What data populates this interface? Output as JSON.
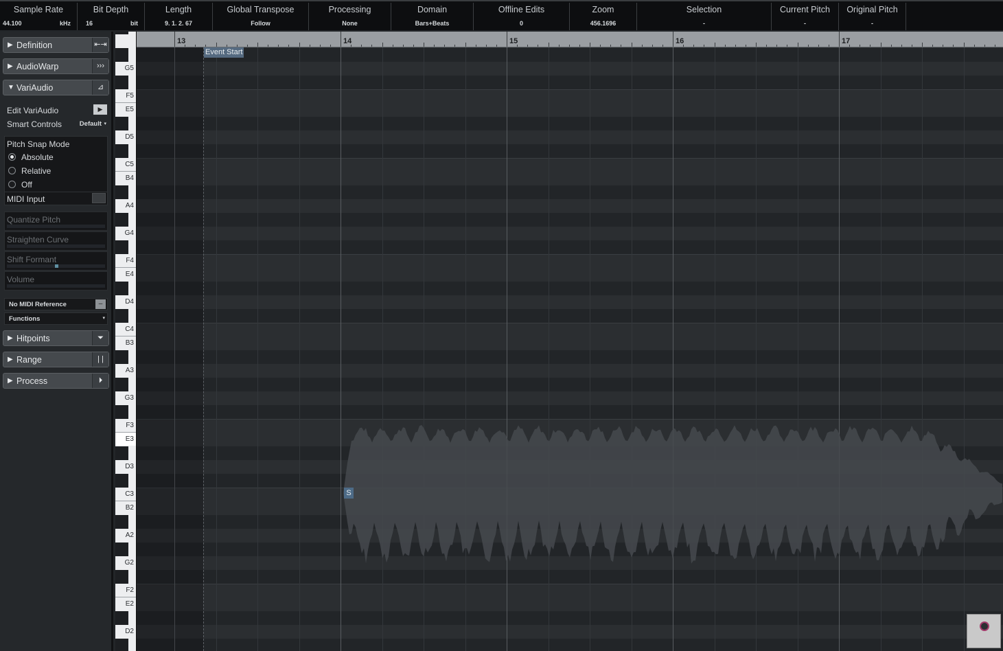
{
  "infoline": {
    "sample_rate": {
      "label": "Sample Rate",
      "value": "44.100",
      "unit": "kHz"
    },
    "bit_depth": {
      "label": "Bit Depth",
      "value": "16",
      "unit": "bit"
    },
    "length": {
      "label": "Length",
      "value": "9. 1. 2. 67"
    },
    "global_transpose": {
      "label": "Global Transpose",
      "value": "Follow"
    },
    "processing": {
      "label": "Processing",
      "value": "None"
    },
    "domain": {
      "label": "Domain",
      "value": "Bars+Beats"
    },
    "offline_edits": {
      "label": "Offline Edits",
      "value": "0"
    },
    "zoom": {
      "label": "Zoom",
      "value": "456.1696"
    },
    "selection": {
      "label": "Selection",
      "value": "-"
    },
    "current_pitch": {
      "label": "Current Pitch",
      "value": "-"
    },
    "original_pitch": {
      "label": "Original Pitch",
      "value": "-"
    }
  },
  "inspector": {
    "sections": {
      "definition": "Definition",
      "audiowarp": "AudioWarp",
      "variaudio": "VariAudio",
      "hitpoints": "Hitpoints",
      "range": "Range",
      "process": "Process"
    },
    "variaudio": {
      "edit_label": "Edit VariAudio",
      "smart_controls_label": "Smart Controls",
      "smart_controls_value": "Default",
      "pitch_snap_title": "Pitch Snap Mode",
      "snap_options": [
        "Absolute",
        "Relative",
        "Off"
      ],
      "snap_selected": "Absolute",
      "midi_input_label": "MIDI Input",
      "sliders": [
        {
          "label": "Quantize Pitch",
          "value": 0
        },
        {
          "label": "Straighten Curve",
          "value": 0
        },
        {
          "label": "Shift Formant",
          "value": 0.5
        },
        {
          "label": "Volume",
          "value": 0
        }
      ],
      "midi_reference": "No MIDI Reference",
      "functions": "Functions"
    }
  },
  "ruler": {
    "bars": [
      "13",
      "14",
      "15",
      "16",
      "17"
    ]
  },
  "keyboard": {
    "labels": [
      "G5",
      "F5",
      "E5",
      "D5",
      "C5",
      "B4",
      "A4",
      "G4",
      "F4",
      "E4",
      "D4",
      "C4",
      "B3",
      "A3",
      "G3",
      "F3",
      "E3",
      "D3",
      "C3",
      "B2",
      "A2",
      "G2",
      "F2",
      "E2",
      "D2"
    ],
    "active_key": "E3"
  },
  "editor": {
    "event_start_label": "Event Start",
    "segment_marker": "S"
  },
  "colors": {
    "background": "#232629",
    "waveform": "#45494d",
    "accent": "#5f8fa1"
  }
}
